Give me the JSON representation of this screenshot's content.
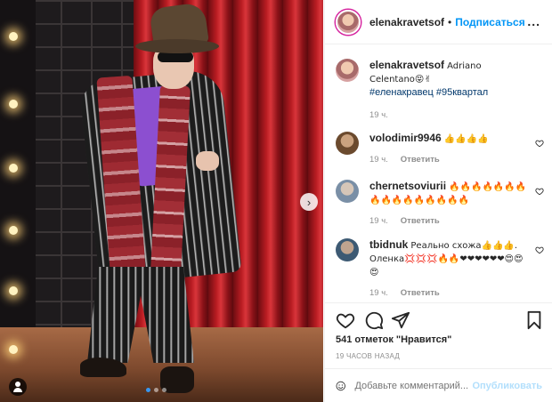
{
  "header": {
    "username": "elenakravetsof",
    "separator": "•",
    "follow_label": "Подписаться",
    "more_label": "..."
  },
  "caption": {
    "username": "elenakravetsof",
    "text": "Adriano Celentano😝✌",
    "hashtags": "#еленакравец #95квартал",
    "time": "19 ч."
  },
  "comments": [
    {
      "username": "volodimir9946",
      "text": "👍👍👍👍",
      "time": "19 ч.",
      "reply": "Ответить"
    },
    {
      "username": "chernetsoviurii",
      "text": "🔥🔥🔥🔥🔥🔥🔥🔥🔥🔥🔥🔥🔥🔥🔥🔥",
      "time": "19 ч.",
      "reply": "Ответить"
    },
    {
      "username": "tbidnuk",
      "text": "Реально схожа👍👍👍. Оленка💢💢💢🔥🔥❤❤❤❤❤❤😍😍😍",
      "time": "19 ч.",
      "reply": "Ответить"
    }
  ],
  "likes_label": "541 отметок \"Нравится\"",
  "time_ago": "19 ЧАСОВ НАЗАД",
  "composer": {
    "placeholder": "Добавьте комментарий...",
    "publish_label": "Опубликовать"
  },
  "photo": {
    "next_label": "›",
    "slides_total": 3,
    "active_slide": 1
  },
  "colors": {
    "follow": "#0095f6",
    "hashtag": "#00376b",
    "publish_disabled": "#b2dffc",
    "active_dot": "#3897f0"
  }
}
